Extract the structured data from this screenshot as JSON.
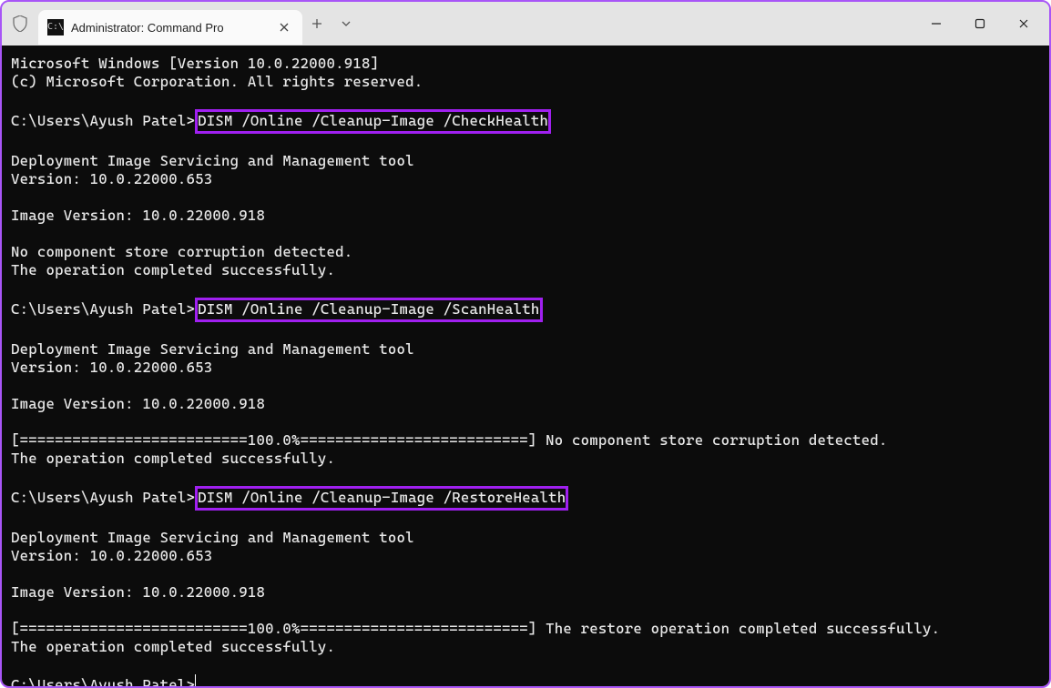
{
  "window": {
    "tab_title": "Administrator: Command Pro",
    "controls": {
      "minimize": "—",
      "maximize": "□",
      "close": "✕"
    }
  },
  "terminal": {
    "banner1": "Microsoft Windows [Version 10.0.22000.918]",
    "banner2": "(c) Microsoft Corporation. All rights reserved.",
    "prompt": "C:\\Users\\Ayush Patel>",
    "cmd_check": "DISM /Online /Cleanup-Image /CheckHealth",
    "cmd_scan": "DISM /Online /Cleanup-Image /ScanHealth",
    "cmd_restore": "DISM /Online /Cleanup-Image /RestoreHealth",
    "tool_name": "Deployment Image Servicing and Management tool",
    "tool_version": "Version: 10.0.22000.653",
    "image_version": "Image Version: 10.0.22000.918",
    "no_corruption": "No component store corruption detected.",
    "op_success": "The operation completed successfully.",
    "progress_scan": "[==========================100.0%==========================] No component store corruption detected.",
    "progress_restore": "[==========================100.0%==========================] The restore operation completed successfully."
  },
  "icons": {
    "tab_prompt": "C:\\",
    "shield": "shield-icon",
    "tab_close": "close-icon",
    "new_tab": "plus-icon",
    "tab_menu": "chevron-down-icon",
    "minimize": "minimize-icon",
    "maximize": "maximize-icon",
    "close": "close-icon"
  }
}
